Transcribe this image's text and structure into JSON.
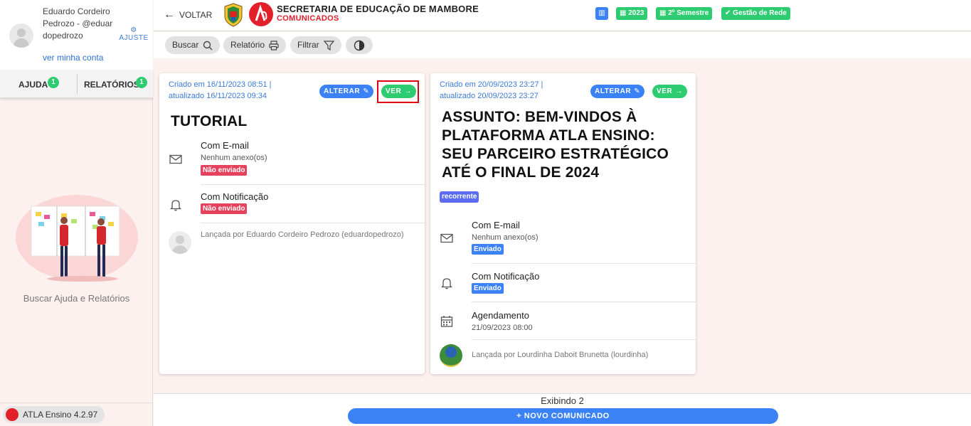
{
  "user": {
    "name_line": "Eduardo Cordeiro Pedrozo - @eduardopedrozo",
    "ajuste_label": "AJUSTE",
    "account_link": "ver minha conta"
  },
  "sidebar": {
    "tabs": [
      {
        "label": "AJUDA",
        "count": "1"
      },
      {
        "label": "RELATÓRIOS",
        "count": "1"
      }
    ],
    "empty_text": "Buscar Ajuda e Relatórios",
    "version": "ATLA Ensino 4.2.97"
  },
  "header": {
    "back_label": "VOLTAR",
    "org_title": "SECRETARIA DE EDUCAÇÃO DE MAMBORE",
    "org_subtitle": "COMUNICADOS",
    "chips": {
      "year": "2023",
      "semester": "2º Semestre",
      "network": "Gestão de Rede"
    }
  },
  "toolbar": {
    "search_label": "Buscar",
    "report_label": "Relatório",
    "filter_label": "Filtrar"
  },
  "cards": [
    {
      "meta_line1": "Criado em 16/11/2023 08:51 |",
      "meta_line2": "atualizado 16/11/2023 09:34",
      "edit_label": "ALTERAR",
      "view_label": "VER",
      "title": "TUTORIAL",
      "email_title": "Com E-mail",
      "email_sub": "Nenhum anexo(os)",
      "email_status": "Não enviado",
      "notif_title": "Com Notificação",
      "notif_status": "Não enviado",
      "launcher": "Lançada por Eduardo Cordeiro Pedrozo (eduardopedrozo)"
    },
    {
      "meta_line1": "Criado em 20/09/2023 23:27 |",
      "meta_line2": "atualizado 20/09/2023 23:27",
      "edit_label": "ALTERAR",
      "view_label": "VER",
      "title_lines": [
        "ASSUNTO: BEM-VINDOS À",
        "PLATAFORMA ATLA ENSINO:",
        "SEU PARCEIRO ESTRATÉGICO",
        "ATÉ O FINAL DE 2024"
      ],
      "tag": "recorrente",
      "email_title": "Com E-mail",
      "email_sub": "Nenhum anexo(os)",
      "email_status": "Enviado",
      "notif_title": "Com Notificação",
      "notif_status": "Enviado",
      "schedule_title": "Agendamento",
      "schedule_value": "21/09/2023 08:00",
      "launcher": "Lançada por Lourdinha Daboit Brunetta (lourdinha)"
    }
  ],
  "footer": {
    "showing": "Exibindo 2",
    "new_button": "+ NOVO COMUNICADO"
  },
  "colors": {
    "accent_blue": "#3b82f6",
    "accent_green": "#2ecc71",
    "brand_red": "#e2202a",
    "status_red": "#e5425d"
  }
}
